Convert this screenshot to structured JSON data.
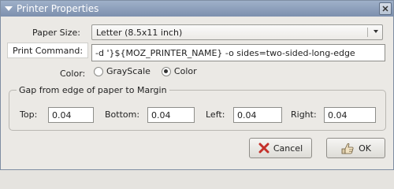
{
  "window": {
    "title": "Printer Properties"
  },
  "paper_size": {
    "label": "Paper Size:",
    "selected": "Letter (8.5x11 inch)"
  },
  "print_command": {
    "label": "Print Command:",
    "value": "-d '}${MOZ_PRINTER_NAME} -o sides=two-sided-long-edge"
  },
  "color": {
    "label": "Color:",
    "options": [
      "GrayScale",
      "Color"
    ],
    "selected": "Color"
  },
  "gap": {
    "title": "Gap from edge of paper to Margin",
    "fields": [
      {
        "label": "Top:",
        "value": "0.04"
      },
      {
        "label": "Bottom:",
        "value": "0.04"
      },
      {
        "label": "Left:",
        "value": "0.04"
      },
      {
        "label": "Right:",
        "value": "0.04"
      }
    ]
  },
  "buttons": {
    "cancel_label": "Cancel",
    "ok_label": "OK"
  },
  "icons": {
    "window_menu": "chevron-down-icon",
    "close": "close-icon",
    "cancel": "cancel-x-icon",
    "ok": "ok-hand-icon",
    "dropdown": "chevron-down-icon"
  }
}
